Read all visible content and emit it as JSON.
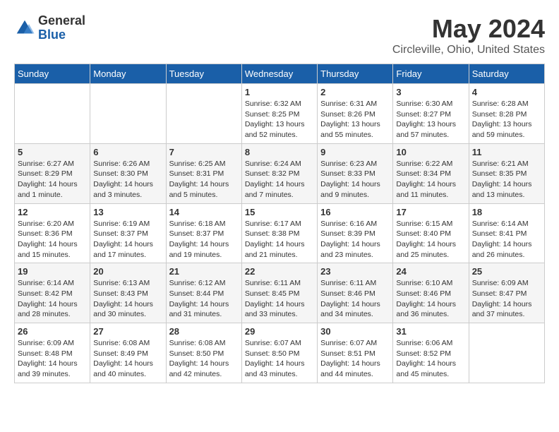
{
  "logo": {
    "general": "General",
    "blue": "Blue"
  },
  "title": "May 2024",
  "subtitle": "Circleville, Ohio, United States",
  "days_of_week": [
    "Sunday",
    "Monday",
    "Tuesday",
    "Wednesday",
    "Thursday",
    "Friday",
    "Saturday"
  ],
  "weeks": [
    [
      {
        "day": "",
        "info": ""
      },
      {
        "day": "",
        "info": ""
      },
      {
        "day": "",
        "info": ""
      },
      {
        "day": "1",
        "info": "Sunrise: 6:32 AM\nSunset: 8:25 PM\nDaylight: 13 hours\nand 52 minutes."
      },
      {
        "day": "2",
        "info": "Sunrise: 6:31 AM\nSunset: 8:26 PM\nDaylight: 13 hours\nand 55 minutes."
      },
      {
        "day": "3",
        "info": "Sunrise: 6:30 AM\nSunset: 8:27 PM\nDaylight: 13 hours\nand 57 minutes."
      },
      {
        "day": "4",
        "info": "Sunrise: 6:28 AM\nSunset: 8:28 PM\nDaylight: 13 hours\nand 59 minutes."
      }
    ],
    [
      {
        "day": "5",
        "info": "Sunrise: 6:27 AM\nSunset: 8:29 PM\nDaylight: 14 hours\nand 1 minute."
      },
      {
        "day": "6",
        "info": "Sunrise: 6:26 AM\nSunset: 8:30 PM\nDaylight: 14 hours\nand 3 minutes."
      },
      {
        "day": "7",
        "info": "Sunrise: 6:25 AM\nSunset: 8:31 PM\nDaylight: 14 hours\nand 5 minutes."
      },
      {
        "day": "8",
        "info": "Sunrise: 6:24 AM\nSunset: 8:32 PM\nDaylight: 14 hours\nand 7 minutes."
      },
      {
        "day": "9",
        "info": "Sunrise: 6:23 AM\nSunset: 8:33 PM\nDaylight: 14 hours\nand 9 minutes."
      },
      {
        "day": "10",
        "info": "Sunrise: 6:22 AM\nSunset: 8:34 PM\nDaylight: 14 hours\nand 11 minutes."
      },
      {
        "day": "11",
        "info": "Sunrise: 6:21 AM\nSunset: 8:35 PM\nDaylight: 14 hours\nand 13 minutes."
      }
    ],
    [
      {
        "day": "12",
        "info": "Sunrise: 6:20 AM\nSunset: 8:36 PM\nDaylight: 14 hours\nand 15 minutes."
      },
      {
        "day": "13",
        "info": "Sunrise: 6:19 AM\nSunset: 8:37 PM\nDaylight: 14 hours\nand 17 minutes."
      },
      {
        "day": "14",
        "info": "Sunrise: 6:18 AM\nSunset: 8:37 PM\nDaylight: 14 hours\nand 19 minutes."
      },
      {
        "day": "15",
        "info": "Sunrise: 6:17 AM\nSunset: 8:38 PM\nDaylight: 14 hours\nand 21 minutes."
      },
      {
        "day": "16",
        "info": "Sunrise: 6:16 AM\nSunset: 8:39 PM\nDaylight: 14 hours\nand 23 minutes."
      },
      {
        "day": "17",
        "info": "Sunrise: 6:15 AM\nSunset: 8:40 PM\nDaylight: 14 hours\nand 25 minutes."
      },
      {
        "day": "18",
        "info": "Sunrise: 6:14 AM\nSunset: 8:41 PM\nDaylight: 14 hours\nand 26 minutes."
      }
    ],
    [
      {
        "day": "19",
        "info": "Sunrise: 6:14 AM\nSunset: 8:42 PM\nDaylight: 14 hours\nand 28 minutes."
      },
      {
        "day": "20",
        "info": "Sunrise: 6:13 AM\nSunset: 8:43 PM\nDaylight: 14 hours\nand 30 minutes."
      },
      {
        "day": "21",
        "info": "Sunrise: 6:12 AM\nSunset: 8:44 PM\nDaylight: 14 hours\nand 31 minutes."
      },
      {
        "day": "22",
        "info": "Sunrise: 6:11 AM\nSunset: 8:45 PM\nDaylight: 14 hours\nand 33 minutes."
      },
      {
        "day": "23",
        "info": "Sunrise: 6:11 AM\nSunset: 8:46 PM\nDaylight: 14 hours\nand 34 minutes."
      },
      {
        "day": "24",
        "info": "Sunrise: 6:10 AM\nSunset: 8:46 PM\nDaylight: 14 hours\nand 36 minutes."
      },
      {
        "day": "25",
        "info": "Sunrise: 6:09 AM\nSunset: 8:47 PM\nDaylight: 14 hours\nand 37 minutes."
      }
    ],
    [
      {
        "day": "26",
        "info": "Sunrise: 6:09 AM\nSunset: 8:48 PM\nDaylight: 14 hours\nand 39 minutes."
      },
      {
        "day": "27",
        "info": "Sunrise: 6:08 AM\nSunset: 8:49 PM\nDaylight: 14 hours\nand 40 minutes."
      },
      {
        "day": "28",
        "info": "Sunrise: 6:08 AM\nSunset: 8:50 PM\nDaylight: 14 hours\nand 42 minutes."
      },
      {
        "day": "29",
        "info": "Sunrise: 6:07 AM\nSunset: 8:50 PM\nDaylight: 14 hours\nand 43 minutes."
      },
      {
        "day": "30",
        "info": "Sunrise: 6:07 AM\nSunset: 8:51 PM\nDaylight: 14 hours\nand 44 minutes."
      },
      {
        "day": "31",
        "info": "Sunrise: 6:06 AM\nSunset: 8:52 PM\nDaylight: 14 hours\nand 45 minutes."
      },
      {
        "day": "",
        "info": ""
      }
    ]
  ]
}
